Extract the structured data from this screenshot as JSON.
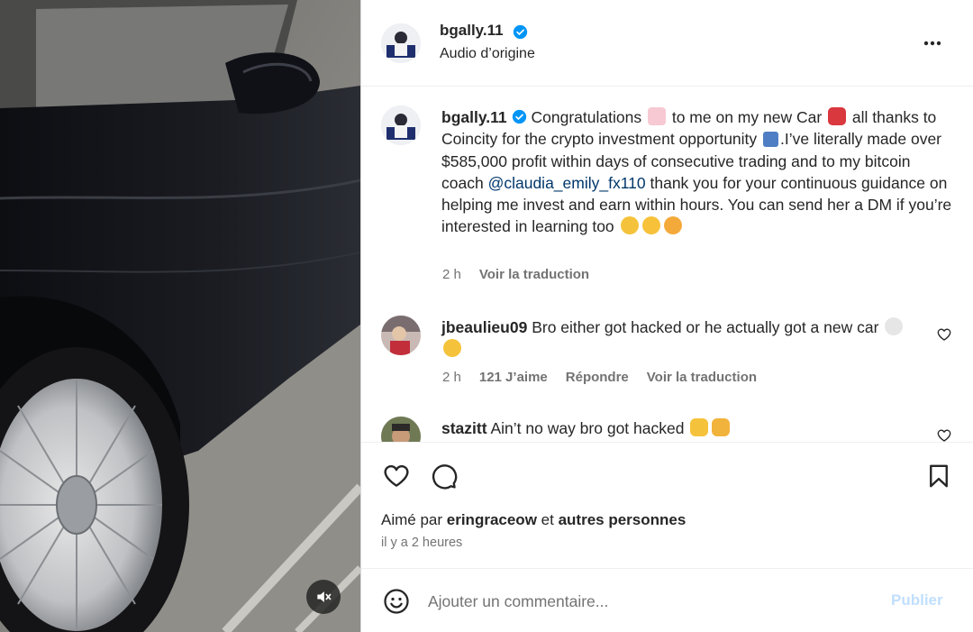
{
  "post": {
    "username": "bgally.11",
    "audio": "Audio d’origine",
    "caption": {
      "part1": "Congratulations",
      "part2": "to me on my new Car",
      "part3": "all thanks to Coincity for the crypto investment opportunity",
      "part4": ".I’ve literally made over $585,000 profit within days of consecutive trading and to my bitcoin coach",
      "mention": "@claudia_emily_fx110",
      "part5": "thank you for your continuous guidance on helping me invest and earn within hours. You can send her a DM if you’re interested in learning too",
      "time": "2 h",
      "translate": "Voir la traduction"
    }
  },
  "comments": [
    {
      "username": "jbeaulieu09",
      "text": "Bro either got hacked or he actually got a new car",
      "time": "2 h",
      "likes": "121 J’aime",
      "reply": "Répondre",
      "translate": "Voir la traduction"
    },
    {
      "username": "stazitt",
      "text": "Ain’t no way bro got hacked"
    }
  ],
  "actions": {
    "liked_by_prefix": "Aimé par",
    "liked_by_user": "eringraceow",
    "liked_by_mid": "et",
    "liked_by_suffix": "autres personnes",
    "time_ago": "il y a 2 heures"
  },
  "composer": {
    "placeholder": "Ajouter un commentaire...",
    "post_label": "Publier"
  },
  "icons": {
    "verified": "verified-badge-icon",
    "more": "more-horizontal-icon",
    "like": "heart-icon",
    "comment": "comment-bubble-icon",
    "save": "bookmark-icon",
    "emoji": "smiley-icon",
    "mute": "speaker-muted-icon"
  },
  "colors": {
    "verified": "#0095f6",
    "mention": "#00376b",
    "post_button_disabled": "#c0dffd",
    "secondary_text": "#737373"
  }
}
